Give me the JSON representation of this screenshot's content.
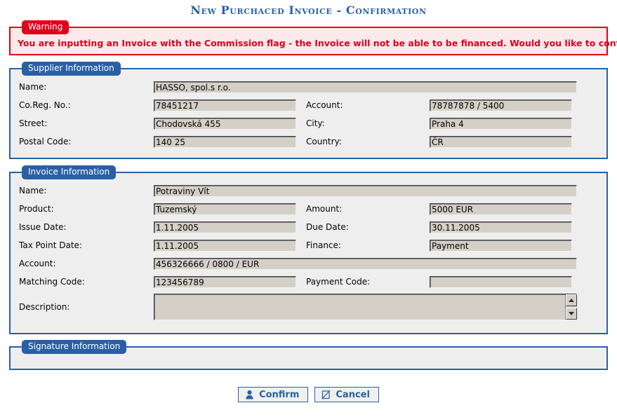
{
  "page": {
    "title": "New Purchaced Invoice - Confirmation",
    "accent_color": "#2a5fa5",
    "warning_color": "#e0001b",
    "field_bg": "#d4d0c8",
    "panel_bg": "#eeeeee"
  },
  "warning": {
    "legend": "Warning",
    "message": "You are inputting an Invoice with the Commission flag - the Invoice will not be able to be financed. Would you like to continue?"
  },
  "supplier": {
    "legend": "Supplier Information",
    "rows": [
      {
        "label": "Name:",
        "value": "HASSO, spol.s r.o."
      },
      {
        "label": "Co.Reg. No.:",
        "value": "78451217",
        "label2": "Account:",
        "value2": "78787878 / 5400"
      },
      {
        "label": "Street:",
        "value": "Chodovská 455",
        "label2": "City:",
        "value2": "Praha 4"
      },
      {
        "label": "Postal Code:",
        "value": "140 25",
        "label2": "Country:",
        "value2": "ČR"
      }
    ]
  },
  "invoice": {
    "legend": "Invoice Information",
    "rows": [
      {
        "label": "Name:",
        "value": "Potraviny Vít"
      },
      {
        "label": "Product:",
        "value": "Tuzemský",
        "label2": "Amount:",
        "value2": "5000 EUR"
      },
      {
        "label": "Issue Date:",
        "value": "1.11.2005",
        "label2": "Due Date:",
        "value2": "30.11.2005"
      },
      {
        "label": "Tax Point Date:",
        "value": "1.11.2005",
        "label2": "Finance:",
        "value2": "Payment"
      },
      {
        "label": "Account:",
        "value": "456326666 / 0800 / EUR"
      },
      {
        "label": "Matching Code:",
        "value": "123456789",
        "label2": "Payment Code:",
        "value2": ""
      }
    ],
    "description": {
      "label": "Description:",
      "value": ""
    }
  },
  "signature": {
    "legend": "Signature Information"
  },
  "buttons": {
    "confirm": {
      "label": "Confirm",
      "icon": "user-icon"
    },
    "cancel": {
      "label": "Cancel",
      "icon": "void-square-icon"
    }
  }
}
